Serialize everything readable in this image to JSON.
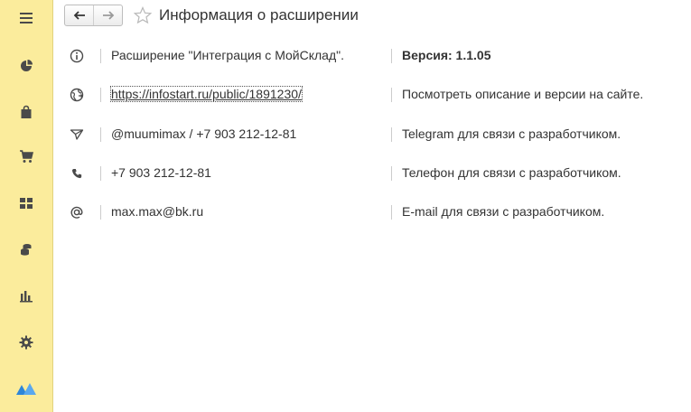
{
  "window": {
    "title": "Информация о расширении"
  },
  "toolbar": {
    "back": "back-arrow-icon",
    "forward": "forward-arrow-icon",
    "favorite": "star-icon"
  },
  "sidebar": {
    "items": [
      {
        "icon": "menu-icon"
      },
      {
        "icon": "pie-chart-icon"
      },
      {
        "icon": "shopping-bag-icon"
      },
      {
        "icon": "cart-icon"
      },
      {
        "icon": "grid-icon"
      },
      {
        "icon": "coins-icon"
      },
      {
        "icon": "bar-chart-icon"
      },
      {
        "icon": "gear-icon"
      },
      {
        "icon": "moysklad-logo-icon"
      }
    ]
  },
  "rows": [
    {
      "icon": "info-icon",
      "value": "Расширение \"Интеграция с МойСклад\".",
      "desc": "Версия: 1.1.05"
    },
    {
      "icon": "globe-icon",
      "value": "https://infostart.ru/public/1891230/",
      "desc": "Посмотреть описание и версии на сайте."
    },
    {
      "icon": "telegram-icon",
      "value": "@muumimax / +7 903 212-12-81",
      "desc": "Telegram для связи с разработчиком."
    },
    {
      "icon": "phone-icon",
      "value": "+7 903 212-12-81",
      "desc": "Телефон для связи с разработчиком."
    },
    {
      "icon": "at-icon",
      "value": "max.max@bk.ru",
      "desc": "E-mail для связи с разработчиком."
    }
  ],
  "colors": {
    "sidebar_bg": "#fbec9c",
    "link": "#2a5db0",
    "icon": "#4a4a4a"
  }
}
